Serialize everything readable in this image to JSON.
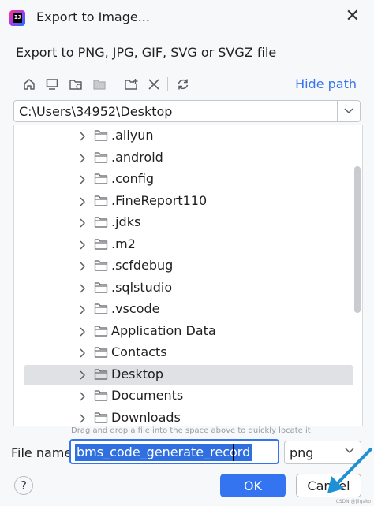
{
  "window": {
    "title": "Export to Image..."
  },
  "subtitle": "Export to PNG, JPG, GIF, SVG or SVGZ file",
  "toolbar": {
    "hide_path_label": "Hide path",
    "icons": [
      "home-icon",
      "desktop-icon",
      "new-folder-icon",
      "folder-disabled-icon",
      "new-folder-plus-icon",
      "delete-icon",
      "refresh-icon"
    ]
  },
  "path": {
    "value": "C:\\Users\\34952\\Desktop"
  },
  "tree": {
    "items": [
      {
        "label": ".aliyun"
      },
      {
        "label": ".android"
      },
      {
        "label": ".config"
      },
      {
        "label": ".FineReport110"
      },
      {
        "label": ".jdks"
      },
      {
        "label": ".m2"
      },
      {
        "label": ".scfdebug"
      },
      {
        "label": ".sqlstudio"
      },
      {
        "label": ".vscode"
      },
      {
        "label": "Application Data"
      },
      {
        "label": "Contacts"
      },
      {
        "label": "Desktop",
        "selected": true
      },
      {
        "label": "Documents"
      },
      {
        "label": "Downloads"
      }
    ]
  },
  "hint": "Drag and drop a file into the space above to quickly locate it",
  "file": {
    "label": "File name:",
    "value": "bms_code_generate_record",
    "type": "png"
  },
  "buttons": {
    "help": "?",
    "ok": "OK",
    "cancel": "Cancel"
  },
  "watermark": "CSDN @jligako",
  "colors": {
    "accent": "#3574f0",
    "annotation_arrow": "#1e90d6"
  }
}
